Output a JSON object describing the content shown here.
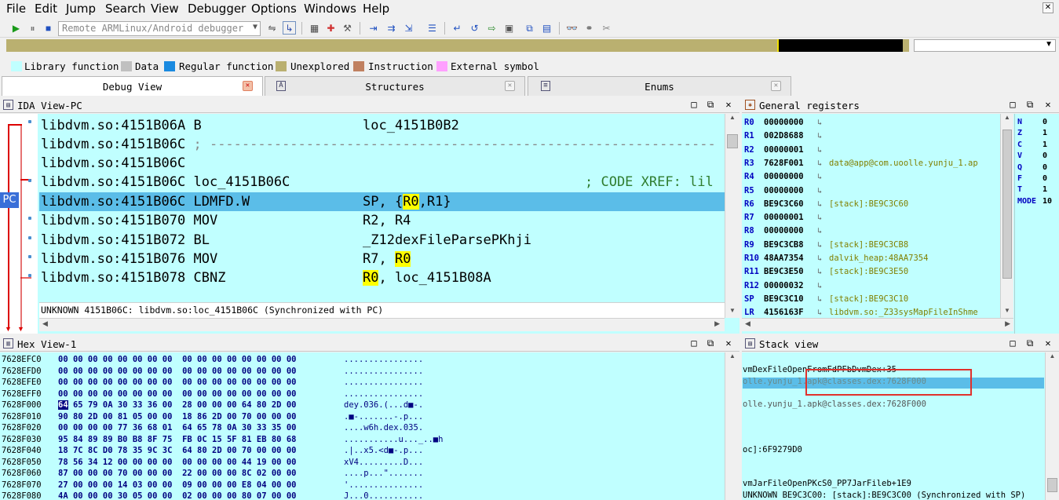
{
  "menu": [
    "File",
    "Edit",
    "Jump",
    "Search",
    "View",
    "Debugger",
    "Options",
    "Windows",
    "Help"
  ],
  "toolbar": {
    "debugger_select": "Remote ARMLinux/Android debugger"
  },
  "legend": [
    {
      "label": "Library function",
      "color": "#c0ffff"
    },
    {
      "label": "Data",
      "color": "#c0c0c0"
    },
    {
      "label": "Regular function",
      "color": "#1a8ae0"
    },
    {
      "label": "Unexplored",
      "color": "#bab070"
    },
    {
      "label": "Instruction",
      "color": "#c08060"
    },
    {
      "label": "External symbol",
      "color": "#ffa0ff"
    }
  ],
  "tabs": [
    {
      "label": "Debug View"
    },
    {
      "label": "Structures"
    },
    {
      "label": "Enums"
    }
  ],
  "ida_view": {
    "title": "IDA View-PC",
    "pc_label": "PC",
    "lines": [
      {
        "addr": "libdvm.so:4151B06A",
        "mn": "B",
        "op": "loc_4151B0B2"
      },
      {
        "addr": "libdvm.so:4151B06C",
        "mn": "; ---------------------------------------------------------------",
        "op": ""
      },
      {
        "addr": "libdvm.so:4151B06C",
        "mn": "",
        "op": ""
      },
      {
        "addr": "libdvm.so:4151B06C",
        "mn": "loc_4151B06C",
        "op": "",
        "cmt": "; CODE XREF: lil"
      },
      {
        "addr": "libdvm.so:4151B06C",
        "mn": "LDMFD.W",
        "op": "SP, {R0,R1}"
      },
      {
        "addr": "libdvm.so:4151B070",
        "mn": "MOV",
        "op": "R2, R4"
      },
      {
        "addr": "libdvm.so:4151B072",
        "mn": "BL",
        "op": "_Z12dexFileParsePKhji"
      },
      {
        "addr": "libdvm.so:4151B076",
        "mn": "MOV",
        "op": "R7, R0"
      },
      {
        "addr": "libdvm.so:4151B078",
        "mn": "CBNZ",
        "op": "R0, loc_4151B08A"
      }
    ],
    "status": "UNKNOWN 4151B06C: libdvm.so:loc_4151B06C (Synchronized with PC)"
  },
  "registers": {
    "title": "General registers",
    "rows": [
      {
        "name": "R0",
        "value": "00000000",
        "comment": ""
      },
      {
        "name": "R1",
        "value": "002D8688",
        "comment": ""
      },
      {
        "name": "R2",
        "value": "00000001",
        "comment": ""
      },
      {
        "name": "R3",
        "value": "7628F001",
        "comment": "data@app@com.uoolle.yunju_1.ap"
      },
      {
        "name": "R4",
        "value": "00000000",
        "comment": ""
      },
      {
        "name": "R5",
        "value": "00000000",
        "comment": ""
      },
      {
        "name": "R6",
        "value": "BE9C3C60",
        "comment": "[stack]:BE9C3C60"
      },
      {
        "name": "R7",
        "value": "00000001",
        "comment": ""
      },
      {
        "name": "R8",
        "value": "00000000",
        "comment": ""
      },
      {
        "name": "R9",
        "value": "BE9C3CB8",
        "comment": "[stack]:BE9C3CB8"
      },
      {
        "name": "R10",
        "value": "48AA7354",
        "comment": "dalvik_heap:48AA7354"
      },
      {
        "name": "R11",
        "value": "BE9C3E50",
        "comment": "[stack]:BE9C3E50"
      },
      {
        "name": "R12",
        "value": "00000032",
        "comment": ""
      },
      {
        "name": "SP",
        "value": "BE9C3C10",
        "comment": "[stack]:BE9C3C10"
      },
      {
        "name": "LR",
        "value": "4156163F",
        "comment": "libdvm.so:_Z33sysMapFileInShme"
      }
    ],
    "flags": [
      {
        "name": "N",
        "value": "0"
      },
      {
        "name": "Z",
        "value": "1"
      },
      {
        "name": "C",
        "value": "1"
      },
      {
        "name": "V",
        "value": "0"
      },
      {
        "name": "Q",
        "value": "0"
      },
      {
        "name": "F",
        "value": "0"
      },
      {
        "name": "T",
        "value": "1"
      },
      {
        "name": "MODE",
        "value": "10"
      }
    ]
  },
  "hex_view": {
    "title": "Hex View-1",
    "rows": [
      {
        "addr": "7628EFC0",
        "b1": "00 00 00 00 00 00 00 00",
        "b2": "00 00 00 00 00 00 00 00",
        "ascii": "................"
      },
      {
        "addr": "7628EFD0",
        "b1": "00 00 00 00 00 00 00 00",
        "b2": "00 00 00 00 00 00 00 00",
        "ascii": "................"
      },
      {
        "addr": "7628EFE0",
        "b1": "00 00 00 00 00 00 00 00",
        "b2": "00 00 00 00 00 00 00 00",
        "ascii": "................"
      },
      {
        "addr": "7628EFF0",
        "b1": "00 00 00 00 00 00 00 00",
        "b2": "00 00 00 00 00 00 00 00",
        "ascii": "................"
      },
      {
        "addr": "7628F000",
        "sel": "64",
        "b1": " 65 79 0A 30 33 36 00",
        "b2": "28 00 00 00 64 80 2D 00",
        "ascii": "dey.036.(...d■-."
      },
      {
        "addr": "7628F010",
        "b1": "90 80 2D 00 81 05 00 00",
        "b2": "18 86 2D 00 70 00 00 00",
        "ascii": ".■-.......-.p..."
      },
      {
        "addr": "7628F020",
        "b1": "00 00 00 00 77 36 68 01",
        "b2": "64 65 78 0A 30 33 35 00",
        "ascii": "....w6h.dex.035."
      },
      {
        "addr": "7628F030",
        "b1": "95 84 89 89 B0 B8 8F 75",
        "b2": "FB 0C 15 5F 81 EB 80 68",
        "ascii": "...........u..._..■h"
      },
      {
        "addr": "7628F040",
        "b1": "18 7C 8C D0 78 35 9C 3C",
        "b2": "64 80 2D 00 70 00 00 00",
        "ascii": ".|..x5.<d■-.p..."
      },
      {
        "addr": "7628F050",
        "b1": "78 56 34 12 00 00 00 00",
        "b2": "00 00 00 00 44 19 00 00",
        "ascii": "xV4.........D..."
      },
      {
        "addr": "7628F060",
        "b1": "87 00 00 00 70 00 00 00",
        "b2": "22 00 00 00 8C 02 00 00",
        "ascii": "....p...\"......."
      },
      {
        "addr": "7628F070",
        "b1": "27 00 00 00 14 03 00 00",
        "b2": "09 00 00 00 E8 04 00 00",
        "ascii": "'..............."
      },
      {
        "addr": "7628F080",
        "b1": "4A 00 00 00 30 05 00 00",
        "b2": "02 00 00 00 80 07 00 00",
        "ascii": "J...0..........."
      }
    ]
  },
  "stack_view": {
    "title": "Stack view",
    "rows": [
      {
        "text": "vmDexFileOpenFromFdPFbDvmDex+35"
      },
      {
        "text": "olle.yunju_1.apk@classes.dex:7628F000"
      },
      {
        "text": ""
      },
      {
        "text": "olle.yunju_1.apk@classes.dex:7628F000"
      },
      {
        "text": ""
      },
      {
        "text": ""
      },
      {
        "text": ""
      },
      {
        "text": "oc]:6F9279D0"
      },
      {
        "text": ""
      },
      {
        "text": ""
      },
      {
        "text": "vmJarFileOpenPKcS0_PP7JarFileb+1E9"
      },
      {
        "text": "UNKNOWN BE9C3C00: [stack]:BE9C3C00 (Synchronized with SP)"
      }
    ]
  }
}
